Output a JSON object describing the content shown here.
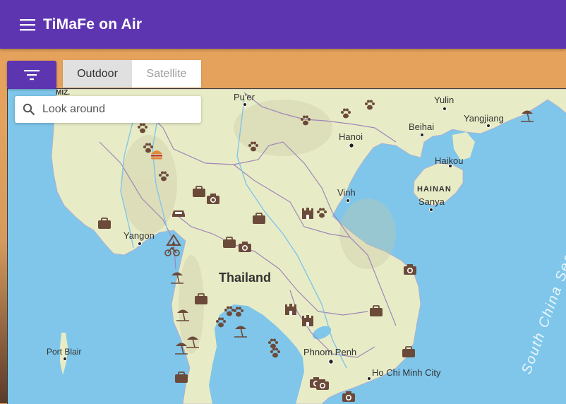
{
  "app": {
    "title": "TiMaFe on Air"
  },
  "icons": {
    "menu": "menu-icon",
    "filter": "filter-icon",
    "search": "search-icon"
  },
  "map_type": {
    "options": [
      "Outdoor",
      "Satellite"
    ],
    "selected": "Outdoor"
  },
  "search": {
    "placeholder": "Look around"
  },
  "map": {
    "labels": {
      "country": "Thailand",
      "sea": "South China Sea",
      "island": "HAINAN",
      "miz": "MIZ.",
      "cities": [
        "Pu'er",
        "Yulin",
        "Yangjiang",
        "Beihai",
        "Hanoi",
        "Haikou",
        "Vinh",
        "Sanya",
        "Yangon",
        "Phnom Penh",
        "Ho Chi Minh City",
        "Port Blair"
      ]
    }
  },
  "colors": {
    "appbar": "#5e35b1",
    "water": "#7fc6ea",
    "land": "#e8ecc6",
    "marker": "#6b4a3a"
  }
}
